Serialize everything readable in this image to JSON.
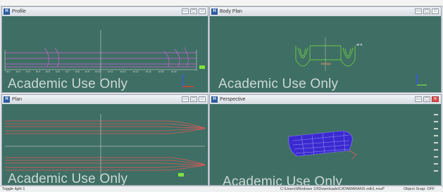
{
  "windows": {
    "profile": {
      "title": "Profile",
      "watermark": "Academic Use Only"
    },
    "body_plan": {
      "title": "Body Plan",
      "watermark": "Academic Use Only",
      "label_top": "wl 9",
      "label_center": "Design"
    },
    "plan": {
      "title": "Plan",
      "watermark": "Academic Use Only"
    },
    "perspective": {
      "title": "Perspective",
      "watermark": "Academic Use Only"
    }
  },
  "status": {
    "left": "Toggle light 1",
    "path": "C:\\Users\\Windows 10\\Downloads\\CATAMARANS edit1.msd*",
    "snap": "Object Snap: OFF"
  },
  "colors": {
    "viewport_bg": "#3f6f64",
    "profile_lines": "#d062d8",
    "plan_lines": "#e0565a",
    "body_lines": "#7fe040",
    "perspective_hull": "#3a2ad0"
  }
}
